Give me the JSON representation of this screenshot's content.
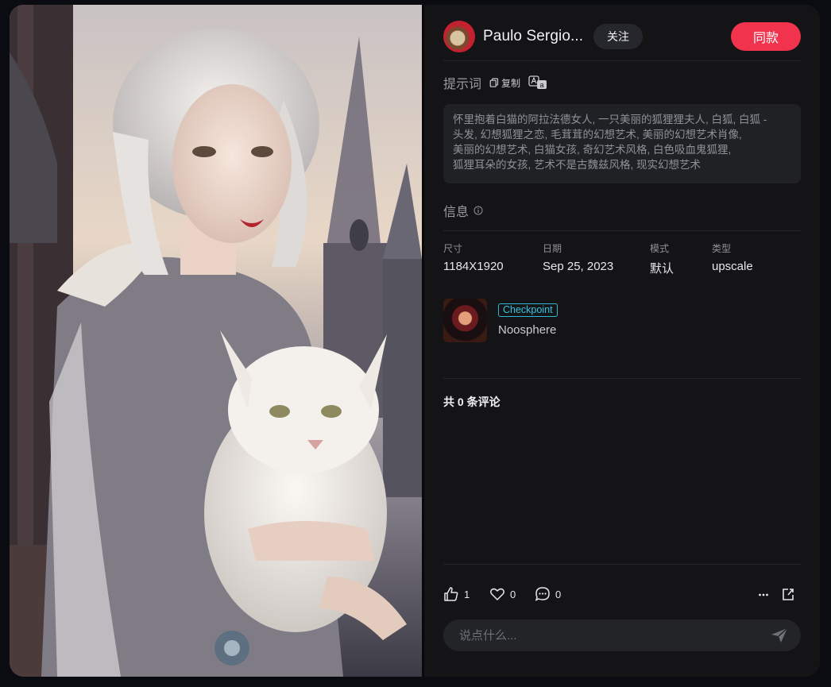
{
  "author": {
    "name": "Paulo Sergio...",
    "follow_label": "关注"
  },
  "same_style_label": "同款",
  "prompt": {
    "label": "提示词",
    "copy_label": "复制",
    "lines": [
      "怀里抱着白猫的阿拉法德女人, 一只美丽的狐狸狸夫人, 白狐, 白狐 -",
      "头发, 幻想狐狸之恋, 毛茸茸的幻想艺术, 美丽的幻想艺术肖像,",
      "美丽的幻想艺术, 白猫女孩, 奇幻艺术风格, 白色吸血鬼狐狸,",
      "狐狸耳朵的女孩, 艺术不是古魏兹风格, 现实幻想艺术"
    ]
  },
  "info": {
    "label": "信息",
    "fields": [
      {
        "key": "尺寸",
        "value": "1184X1920"
      },
      {
        "key": "日期",
        "value": "Sep 25, 2023"
      },
      {
        "key": "模式",
        "value": "默认"
      },
      {
        "key": "类型",
        "value": "upscale"
      }
    ]
  },
  "model": {
    "badge": "Checkpoint",
    "name": "Noosphere"
  },
  "comments": {
    "count_text": "共 0 条评论",
    "placeholder": "说点什么..."
  },
  "actions": {
    "likes": "1",
    "favorites": "0",
    "comments": "0"
  },
  "colors": {
    "accent": "#f2334e",
    "badge": "#35c4e4",
    "panel_bg": "#141417"
  }
}
